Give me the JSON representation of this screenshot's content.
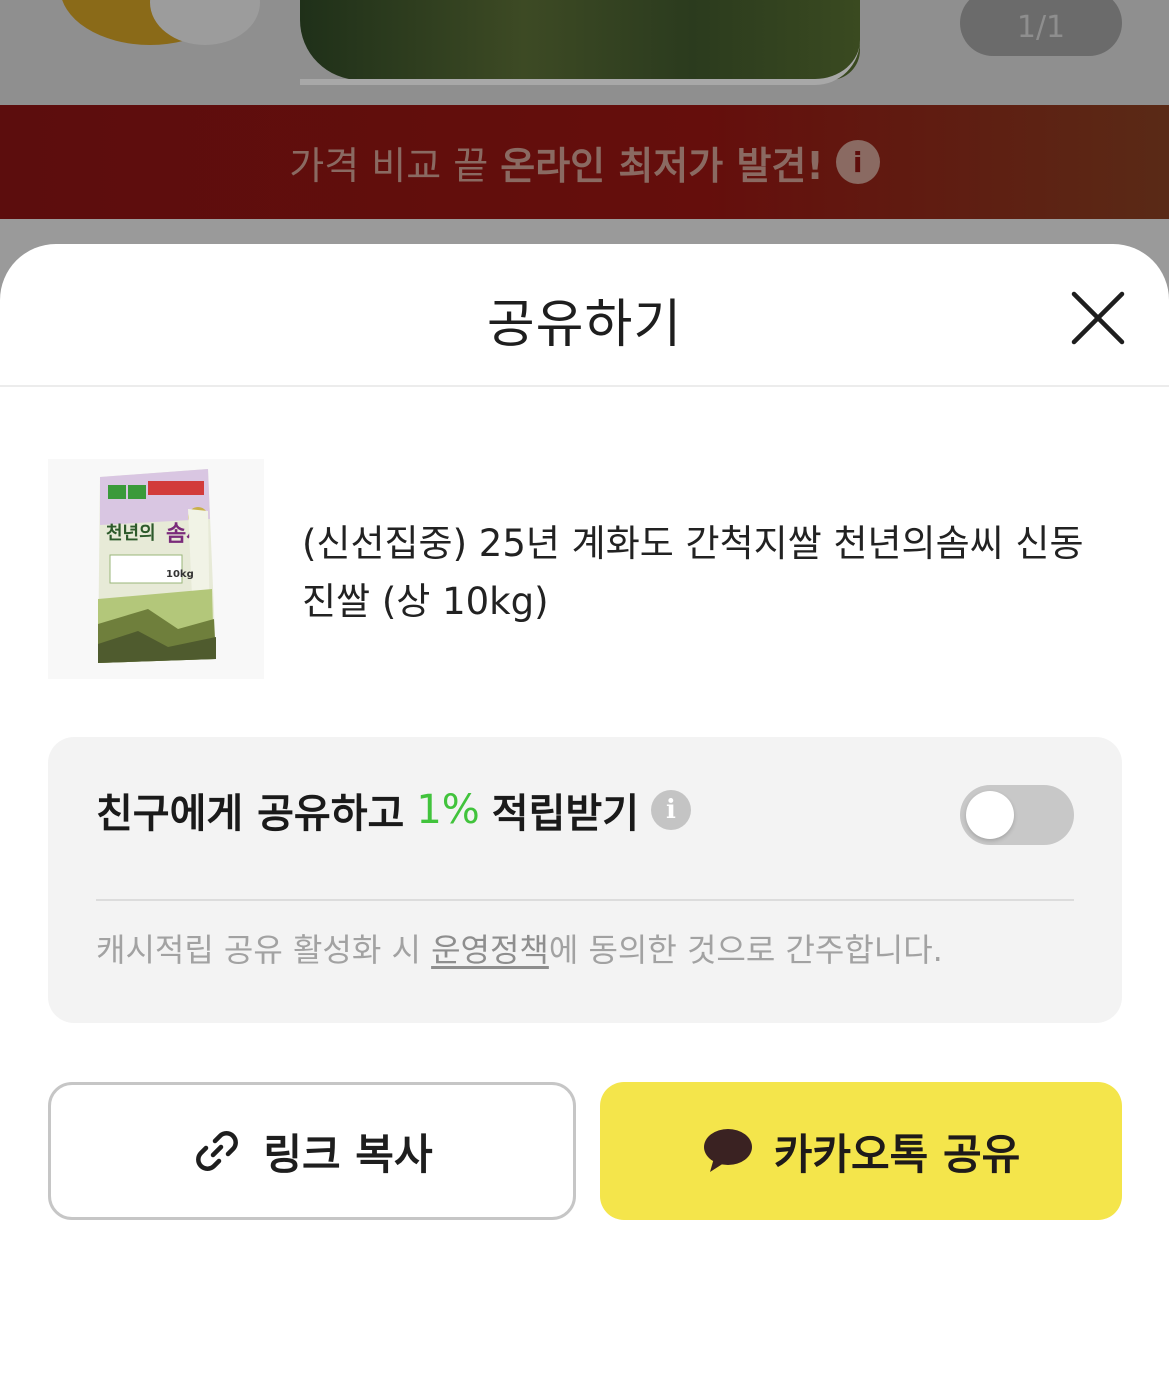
{
  "background": {
    "image_counter": "1/1",
    "banner": {
      "text": "가격 비교 끝",
      "highlight": "온라인 최저가 발견!",
      "info_icon": "info-icon"
    }
  },
  "sheet": {
    "title": "공유하기",
    "close_icon": "close-icon"
  },
  "product": {
    "name": "(신선집중) 25년 계화도 간척지쌀 천년의솜씨 신동진쌀 (상 10kg)"
  },
  "reward": {
    "title_before": "친구에게 공유하고",
    "percent": "1%",
    "title_after": "적립받기",
    "info_icon": "info-icon",
    "toggle_on": false,
    "note_before": "캐시적립 공유 활성화 시",
    "note_link": "운영정책",
    "note_after": "에 동의한 것으로 간주합니다."
  },
  "buttons": {
    "copy_link": {
      "label": "링크 복사",
      "icon": "link-icon"
    },
    "kakao_share": {
      "label": "카카오톡 공유",
      "icon": "speech-bubble-icon"
    }
  },
  "colors": {
    "accent_green": "#41c33c",
    "kakao_yellow": "#f4e54b",
    "banner_red": "#650e0c"
  }
}
